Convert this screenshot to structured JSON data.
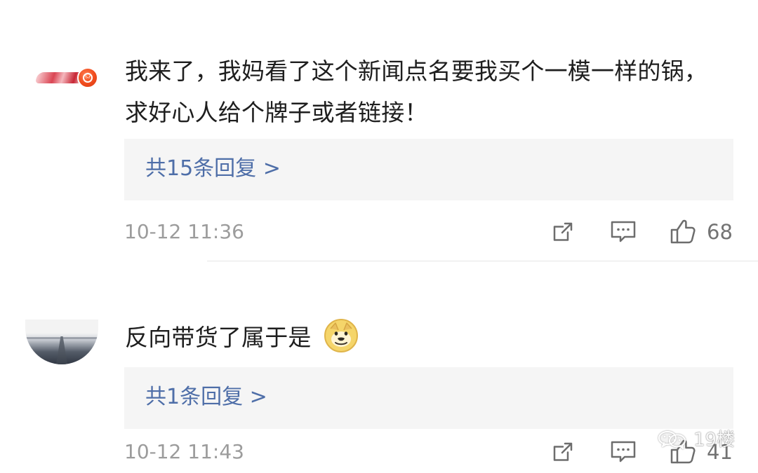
{
  "comments": [
    {
      "text": "我来了，我妈看了这个新闻点名要我买个一模一样的锅，求好心人给个牌子或者链接！",
      "reply_link": "共15条回复 >",
      "time": "10-12 11:36",
      "likes": "68"
    },
    {
      "text": "反向带货了属于是",
      "reply_link": "共1条回复 >",
      "time": "10-12 11:43",
      "likes": "41"
    }
  ],
  "watermark": {
    "brand": "19楼"
  },
  "icons": {
    "share": "share-icon",
    "comment": "comment-icon",
    "like": "thumbs-up-icon",
    "wechat": "wechat-icon",
    "emoji": "doge-emoji"
  },
  "colors": {
    "reply_link": "#4e6ea8",
    "meta_gray": "#9c9c9c",
    "reply_bg": "#f5f5f5"
  }
}
